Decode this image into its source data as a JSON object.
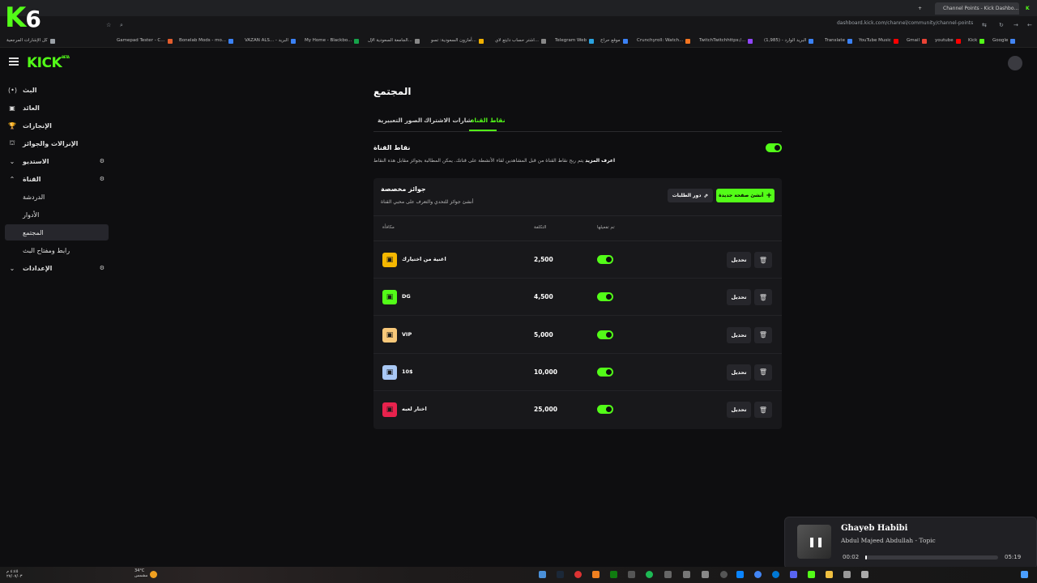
{
  "browser": {
    "tab_title": "Channel Points - Kick Dashbo...",
    "url": "dashboard.kick.com/channel/community/channel-points",
    "overlay_logo": "K",
    "overlay_number": "6",
    "bookmarks": [
      {
        "label": "كل الإشارات المرجعية",
        "color": "#9aa0a6"
      },
      {
        "label": "Gamepad Tester - C...",
        "color": "#e35d2d"
      },
      {
        "label": "Bonelab Mods - mo...",
        "color": "#3b82f6"
      },
      {
        "label": "VAZAN ALS... - البريد",
        "color": "#3b82f6"
      },
      {
        "label": "My Home - Blackbo...",
        "color": "#16a34a"
      },
      {
        "label": "الجامعة السعودية الإل...",
        "color": "#888"
      },
      {
        "label": "أمازون السعودية: تسو...",
        "color": "#f0b000"
      },
      {
        "label": "اشتر حساب دايتع لاي...",
        "color": "#888"
      },
      {
        "label": "Telegram Web",
        "color": "#2aa3e0"
      },
      {
        "label": "موقع حراج",
        "color": "#3b82f6"
      },
      {
        "label": "Crunchyroll: Watch...",
        "color": "#f47521"
      },
      {
        "label": "TwitchTwitchhttps:/...",
        "color": "#9146ff"
      },
      {
        "label": "البريد الوارد - (1,985)",
        "color": "#3b82f6"
      },
      {
        "label": "Translate",
        "color": "#3b82f6"
      },
      {
        "label": "YouTube Music",
        "color": "#ff0000"
      },
      {
        "label": "Gmail",
        "color": "#ea4335"
      },
      {
        "label": "youtube",
        "color": "#ff0000"
      },
      {
        "label": "Kick",
        "color": "#53fc18"
      },
      {
        "label": "Google",
        "color": "#4285f4"
      }
    ]
  },
  "app": {
    "logo": "KICK",
    "logo_beta": "BETA"
  },
  "sidebar": {
    "items": [
      {
        "label": "البث",
        "icon": "broadcast-icon",
        "glyph": "(•)"
      },
      {
        "label": "العائد",
        "icon": "wallet-icon",
        "glyph": "▣"
      },
      {
        "label": "الإنجازات",
        "icon": "trophy-icon",
        "glyph": "🏆"
      },
      {
        "label": "الإنزالات والجوائز",
        "icon": "drops-icon",
        "glyph": "⛫"
      },
      {
        "label": "الاستديو",
        "icon": "studio-icon",
        "glyph": "⌄",
        "right": "⚙"
      },
      {
        "label": "القناة",
        "icon": "channel-icon",
        "glyph": "⌃",
        "right": "⚙"
      }
    ],
    "sub_items": [
      {
        "label": "الدردشة"
      },
      {
        "label": "الأدوار"
      },
      {
        "label": "المجتمع"
      },
      {
        "label": "رابط ومفتاح البث"
      }
    ],
    "settings": {
      "label": "الإعدادات",
      "glyph": "⌄",
      "right": "⚙"
    }
  },
  "main": {
    "title": "المجتمع",
    "tabs": [
      {
        "label": "الصور التعبيرية"
      },
      {
        "label": "شارات الاشتراك"
      },
      {
        "label": "نقاط القناة"
      }
    ],
    "channel_points": {
      "title": "نقاط القناة",
      "desc_bold": "اعرف المزيد",
      "desc": "يتم ربح نقاط القناة من قبل المشاهدين لقاء الأنشطة على قناتك. يمكن المطالبة بجوائز مقابل هذه النقاط",
      "enabled": true
    },
    "rewards": {
      "title": "جوائز مخصصة",
      "desc": "أنشئ جوائز للتحدي والتعرف على محبي القناة",
      "new_button": "أنشئ صفحة جديدة",
      "queue_button": "دور الطلبات",
      "columns": {
        "reward": "مكافأة",
        "cost": "التكلفة",
        "enabled": "تم تفعيلها"
      },
      "edit_label": "تحديل",
      "rows": [
        {
          "name": "اغنية من اختيارك",
          "cost": "2,500",
          "color": "#f5b700",
          "enabled": true
        },
        {
          "name": "DG",
          "cost": "4,500",
          "color": "#53fc18",
          "enabled": true
        },
        {
          "name": "VIP",
          "cost": "5,000",
          "color": "#f8c87a",
          "enabled": true
        },
        {
          "name": "10$",
          "cost": "10,000",
          "color": "#a9c8f5",
          "enabled": true
        },
        {
          "name": "اختار لعبه",
          "cost": "25,000",
          "color": "#e8224d",
          "enabled": true
        }
      ]
    }
  },
  "media": {
    "title": "Ghayeb Habibi",
    "artist": "Abdul Majeed Abdullah - Topic",
    "elapsed": "00:02",
    "duration": "05:19",
    "progress": 0.006
  },
  "taskbar": {
    "clock_time": "٤:٤٥ م",
    "clock_date": "٢٧/٠٧/٠٣",
    "weather": "34°C",
    "weather_desc": "مشمس"
  }
}
